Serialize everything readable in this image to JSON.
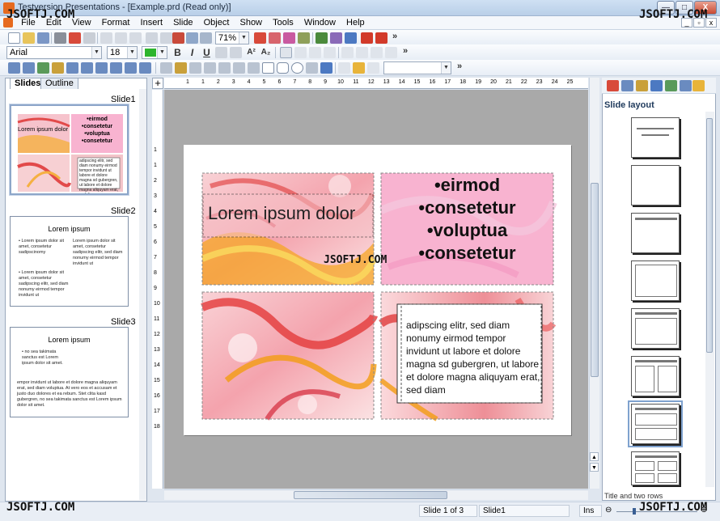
{
  "window": {
    "title": "Testversion Presentations - [Example.prd (Read only)]",
    "min": "—",
    "max": "□",
    "close": "X"
  },
  "menu": [
    "File",
    "Edit",
    "View",
    "Format",
    "Insert",
    "Slide",
    "Object",
    "Show",
    "Tools",
    "Window",
    "Help"
  ],
  "toolbar": {
    "zoom": "71%",
    "font": "Arial",
    "size": "18",
    "more": "»",
    "bold": "B",
    "italic": "I",
    "underline": "U",
    "superscript": "A²",
    "subscript": "A₂"
  },
  "left_panel": {
    "tabs": [
      "Slides",
      "Outline"
    ],
    "slides": [
      {
        "label": "Slide1",
        "title": "Lorem ipsum dolor",
        "bullets": [
          "•eirmod",
          "•consetetur",
          "•voluptua",
          "•consetetur"
        ],
        "body": "adipscing elitr, sed diam nonumy eirmod tempor invidunt ut labore et dolore magna sd gubergren, ut labore et dolore magna aliquyam erat, sed diam"
      },
      {
        "label": "Slide2",
        "title": "Lorem ipsum",
        "col1a": "• Lorem ipsum dolor sit amet, consetetur sadipscinomy",
        "col2a": "Lorem ipsum dolor sit amet, consetetur sadipscing elitr, sed diam nonumy eirmod tempor invidunt ut",
        "col1b": "• Lorem ipsum dolor sit amet, consetetur sadipscing elitr, sed diam nonumy eirmod tempor invidunt ut"
      },
      {
        "label": "Slide3",
        "title": "Lorem ipsum",
        "bullet": "• no sea takimata sanctus est Lorem ipsum dolor sit amet.",
        "para": "empor invidunt ut labore et dolore magna aliquyam erat, sed diam voluptua. At vero eos et accusam et justo duo dolores et ea rebum. Stet clita kasd gubergren, no sea takimata sanctus est Lorem ipsum dolor sit amet."
      }
    ]
  },
  "ruler": {
    "h": [
      "1",
      "1",
      "2",
      "3",
      "4",
      "5",
      "6",
      "7",
      "8",
      "9",
      "10",
      "11",
      "12",
      "13",
      "14",
      "15",
      "16",
      "17",
      "18",
      "19",
      "20",
      "21",
      "22",
      "23",
      "24",
      "25"
    ],
    "v": [
      "1",
      "1",
      "2",
      "3",
      "4",
      "5",
      "6",
      "7",
      "8",
      "9",
      "10",
      "11",
      "12",
      "13",
      "14",
      "15",
      "16",
      "17",
      "18"
    ]
  },
  "slide": {
    "title": "Lorem ipsum dolor",
    "bullets": [
      "•eirmod",
      "•consetetur",
      "•voluptua",
      "•consetetur"
    ],
    "body": "adipscing elitr, sed diam nonumy eirmod tempor invidunt ut labore et dolore magna sd gubergren, ut labore et dolore magna aliquyam erat, sed diam"
  },
  "right_panel": {
    "title": "Slide layout",
    "caption": "Title and two rows"
  },
  "status": {
    "slide_pos": "Slide 1 of 3",
    "slide_name": "Slide1",
    "mode": "Ins"
  },
  "watermark": "JSOFTJ.COM",
  "colors": {
    "pink": "#f7b6cf",
    "accent": "#e66a1f",
    "selection": "#7fa2cf"
  }
}
